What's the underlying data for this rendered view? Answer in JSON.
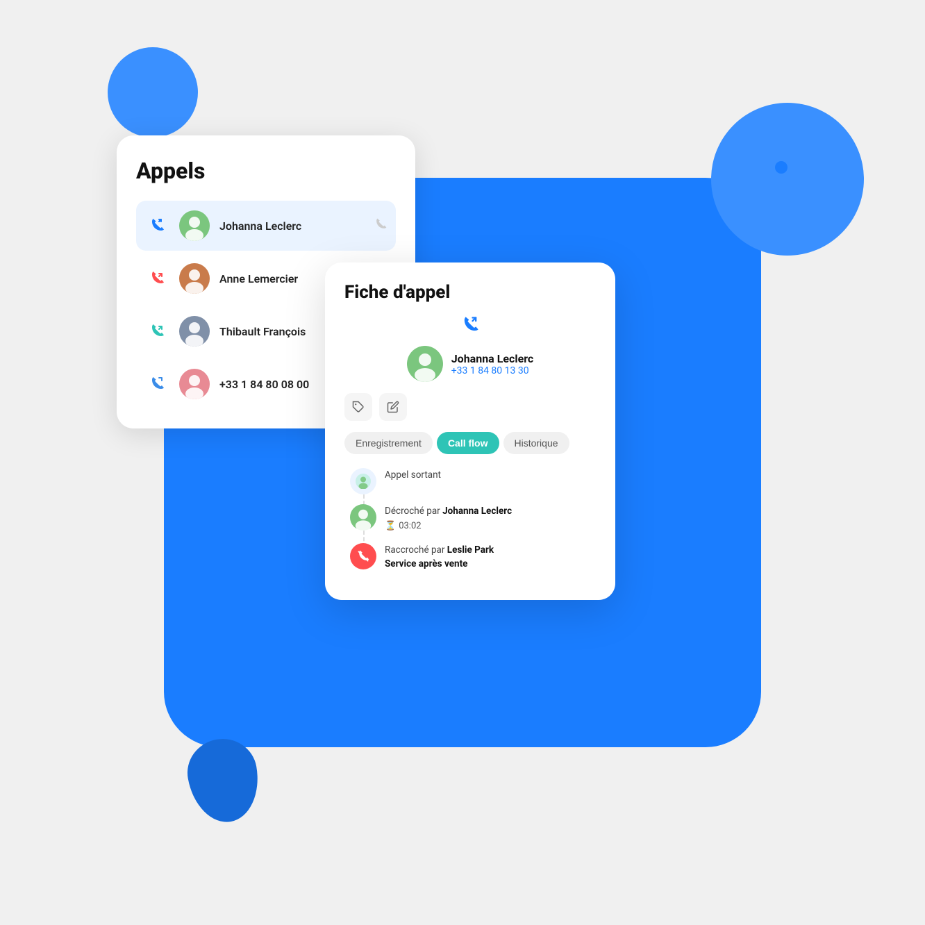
{
  "scene": {
    "bg_color": "#1a7dff"
  },
  "appels_card": {
    "title": "Appels",
    "calls": [
      {
        "id": 1,
        "name": "Johanna Leclerc",
        "type": "outgoing",
        "color": "blue",
        "active": true,
        "has_action": true,
        "action_label": "call"
      },
      {
        "id": 2,
        "name": "Anne Lemercier",
        "type": "incoming_missed",
        "color": "red",
        "active": false,
        "has_action": false
      },
      {
        "id": 3,
        "name": "Thibault François",
        "type": "incoming",
        "color": "teal",
        "active": false,
        "has_action": false
      },
      {
        "id": 4,
        "name": "+33 1 84 80 08 00",
        "type": "outgoing",
        "color": "blue",
        "active": false,
        "has_action": false
      }
    ]
  },
  "fiche_card": {
    "title": "Fiche d'appel",
    "contact": {
      "name": "Johanna Leclerc",
      "phone": "+33 1 84 80 13 30",
      "type": "outgoing"
    },
    "action_buttons": [
      {
        "id": "tag",
        "label": "tag-icon"
      },
      {
        "id": "edit",
        "label": "edit-icon"
      }
    ],
    "tabs": [
      {
        "id": "enregistrement",
        "label": "Enregistrement",
        "active": false
      },
      {
        "id": "callflow",
        "label": "Call flow",
        "active": true
      },
      {
        "id": "historique",
        "label": "Historique",
        "active": false
      }
    ],
    "flow_items": [
      {
        "id": 1,
        "text": "Appel sortant",
        "type": "outgoing",
        "has_connector": true
      },
      {
        "id": 2,
        "text_prefix": "Décroché par ",
        "text_bold": "Johanna Leclerc",
        "duration": "03:02",
        "type": "answered",
        "has_connector": true
      },
      {
        "id": 3,
        "text_prefix": "Raccroché par ",
        "text_bold": "Leslie Park",
        "text_suffix": "",
        "sub_text": "Service après vente",
        "type": "hangup",
        "has_connector": false
      }
    ]
  }
}
